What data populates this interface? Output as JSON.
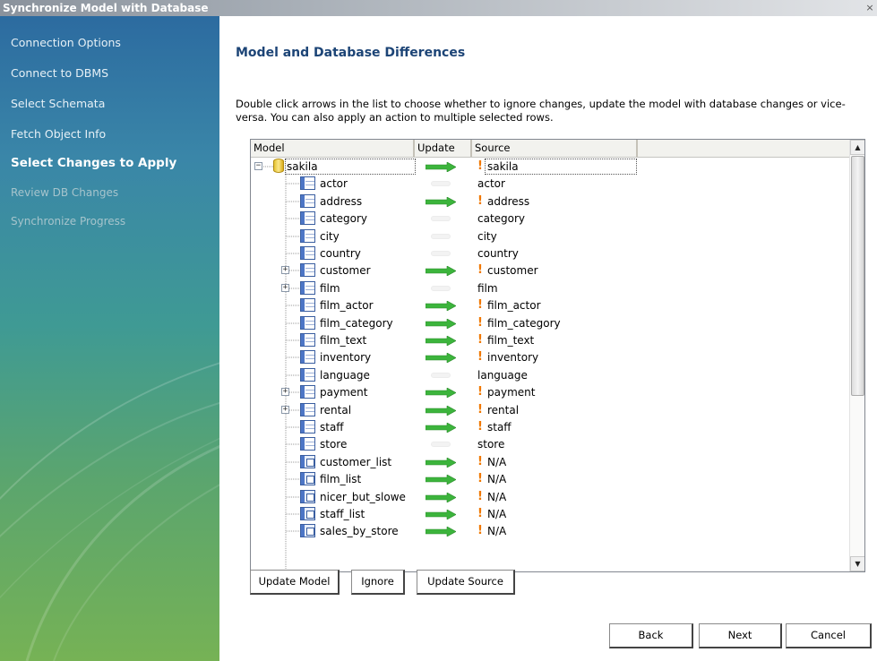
{
  "window": {
    "title": "Synchronize Model with Database",
    "close_glyph": "×"
  },
  "sidebar": {
    "steps": [
      {
        "label": "Connection Options",
        "state": "done"
      },
      {
        "label": "Connect to DBMS",
        "state": "done"
      },
      {
        "label": "Select Schemata",
        "state": "done"
      },
      {
        "label": "Fetch Object Info",
        "state": "done"
      },
      {
        "label": "Select Changes to Apply",
        "state": "active"
      },
      {
        "label": "Review DB Changes",
        "state": "pending"
      },
      {
        "label": "Synchronize Progress",
        "state": "pending"
      }
    ]
  },
  "main": {
    "heading": "Model and Database Differences",
    "description": "Double click arrows in the list to choose whether to ignore changes, update the model with database changes or vice-versa. You can also apply an action to multiple selected rows.",
    "grid": {
      "columns": [
        {
          "label": "Model"
        },
        {
          "label": "Update"
        },
        {
          "label": "Source"
        }
      ],
      "rows": [
        {
          "model": "sakila",
          "kind": "schema",
          "expander": "minus",
          "action": "arrow",
          "source": "sakila",
          "warn": true,
          "selected": true
        },
        {
          "model": "actor",
          "kind": "table",
          "expander": "",
          "action": "none",
          "source": "actor",
          "warn": false
        },
        {
          "model": "address",
          "kind": "table",
          "expander": "",
          "action": "arrow",
          "source": "address",
          "warn": true
        },
        {
          "model": "category",
          "kind": "table",
          "expander": "",
          "action": "none",
          "source": "category",
          "warn": false
        },
        {
          "model": "city",
          "kind": "table",
          "expander": "",
          "action": "none",
          "source": "city",
          "warn": false
        },
        {
          "model": "country",
          "kind": "table",
          "expander": "",
          "action": "none",
          "source": "country",
          "warn": false
        },
        {
          "model": "customer",
          "kind": "table",
          "expander": "plus",
          "action": "arrow",
          "source": "customer",
          "warn": true
        },
        {
          "model": "film",
          "kind": "table",
          "expander": "plus",
          "action": "none",
          "source": "film",
          "warn": false
        },
        {
          "model": "film_actor",
          "kind": "table",
          "expander": "",
          "action": "arrow",
          "source": "film_actor",
          "warn": true
        },
        {
          "model": "film_category",
          "kind": "table",
          "expander": "",
          "action": "arrow",
          "source": "film_category",
          "warn": true
        },
        {
          "model": "film_text",
          "kind": "table",
          "expander": "",
          "action": "arrow",
          "source": "film_text",
          "warn": true
        },
        {
          "model": "inventory",
          "kind": "table",
          "expander": "",
          "action": "arrow",
          "source": "inventory",
          "warn": true
        },
        {
          "model": "language",
          "kind": "table",
          "expander": "",
          "action": "none",
          "source": "language",
          "warn": false
        },
        {
          "model": "payment",
          "kind": "table",
          "expander": "plus",
          "action": "arrow",
          "source": "payment",
          "warn": true
        },
        {
          "model": "rental",
          "kind": "table",
          "expander": "plus",
          "action": "arrow",
          "source": "rental",
          "warn": true
        },
        {
          "model": "staff",
          "kind": "table",
          "expander": "",
          "action": "arrow",
          "source": "staff",
          "warn": true
        },
        {
          "model": "store",
          "kind": "table",
          "expander": "",
          "action": "none",
          "source": "store",
          "warn": false
        },
        {
          "model": "customer_list",
          "kind": "view",
          "expander": "",
          "action": "arrow",
          "source": "N/A",
          "warn": true
        },
        {
          "model": "film_list",
          "kind": "view",
          "expander": "",
          "action": "arrow",
          "source": "N/A",
          "warn": true
        },
        {
          "model": "nicer_but_slowe",
          "kind": "view",
          "expander": "",
          "action": "arrow",
          "source": "N/A",
          "warn": true
        },
        {
          "model": "staff_list",
          "kind": "view",
          "expander": "",
          "action": "arrow",
          "source": "N/A",
          "warn": true
        },
        {
          "model": "sales_by_store",
          "kind": "view",
          "expander": "",
          "action": "arrow",
          "source": "N/A",
          "warn": true
        }
      ],
      "scroll_up_glyph": "▲",
      "scroll_down_glyph": "▼"
    },
    "actions": {
      "update_model": "Update Model",
      "ignore": "Ignore",
      "update_source": "Update Source"
    },
    "nav": {
      "back": "Back",
      "next": "Next",
      "cancel": "Cancel"
    }
  },
  "colors": {
    "heading": "#1c4476",
    "arrow": "#3cb43c",
    "warn": "#f07800"
  },
  "icons": {
    "schema": "database-icon",
    "table": "table-icon",
    "view": "view-icon",
    "arrow": "arrow-right-icon",
    "warn": "warning-icon"
  }
}
